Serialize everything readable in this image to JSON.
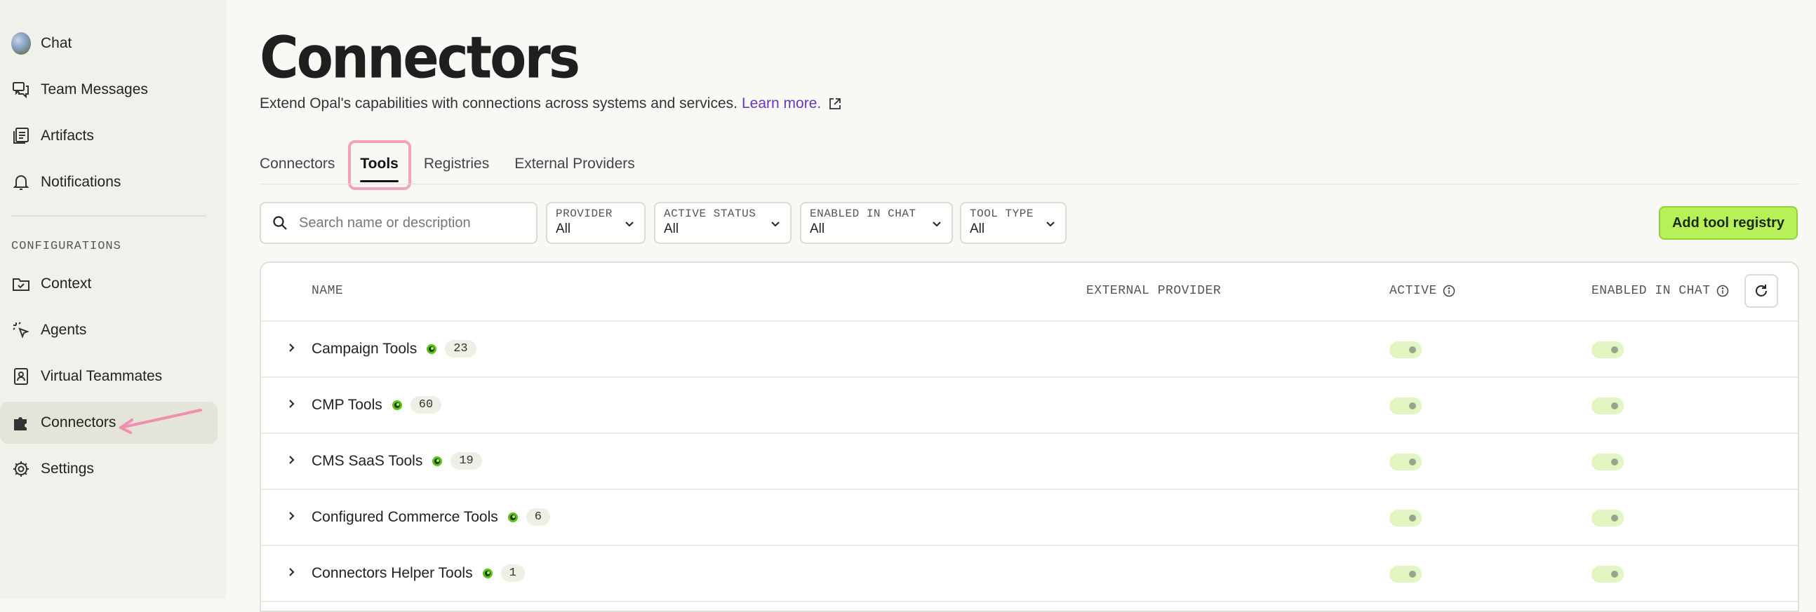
{
  "sidebar": {
    "items": [
      {
        "label": "Chat",
        "icon": "avatar"
      },
      {
        "label": "Team Messages",
        "icon": "messages-icon"
      },
      {
        "label": "Artifacts",
        "icon": "artifacts-icon"
      },
      {
        "label": "Notifications",
        "icon": "bell-icon"
      }
    ],
    "section_label": "CONFIGURATIONS",
    "config_items": [
      {
        "label": "Context",
        "icon": "folder-check-icon"
      },
      {
        "label": "Agents",
        "icon": "agent-cursor-icon"
      },
      {
        "label": "Virtual Teammates",
        "icon": "teammate-badge-icon"
      },
      {
        "label": "Connectors",
        "icon": "puzzle-icon",
        "active": true
      },
      {
        "label": "Settings",
        "icon": "gear-icon"
      }
    ]
  },
  "header": {
    "title": "Connectors",
    "subtitle": "Extend Opal's capabilities with connections across systems and services.",
    "learn_more": "Learn more."
  },
  "tabs": [
    {
      "label": "Connectors"
    },
    {
      "label": "Tools",
      "active": true
    },
    {
      "label": "Registries"
    },
    {
      "label": "External Providers"
    }
  ],
  "search": {
    "placeholder": "Search name or description"
  },
  "filters": [
    {
      "label": "PROVIDER",
      "value": "All"
    },
    {
      "label": "ACTIVE STATUS",
      "value": "All"
    },
    {
      "label": "ENABLED IN CHAT",
      "value": "All"
    },
    {
      "label": "TOOL TYPE",
      "value": "All"
    }
  ],
  "add_button": "Add tool registry",
  "table": {
    "columns": {
      "name": "NAME",
      "external_provider": "EXTERNAL PROVIDER",
      "active": "ACTIVE",
      "enabled_in_chat": "ENABLED IN CHAT"
    },
    "rows": [
      {
        "name": "Campaign Tools",
        "count": "23",
        "active": true,
        "enabled": true
      },
      {
        "name": "CMP Tools",
        "count": "60",
        "active": true,
        "enabled": true
      },
      {
        "name": "CMS SaaS Tools",
        "count": "19",
        "active": true,
        "enabled": true
      },
      {
        "name": "Configured Commerce Tools",
        "count": "6",
        "active": true,
        "enabled": true
      },
      {
        "name": "Connectors Helper Tools",
        "count": "1",
        "active": true,
        "enabled": true
      }
    ]
  },
  "colors": {
    "accent_green": "#b8f05a",
    "link_purple": "#6b35b7",
    "highlight_pink": "#f3a3bd"
  }
}
